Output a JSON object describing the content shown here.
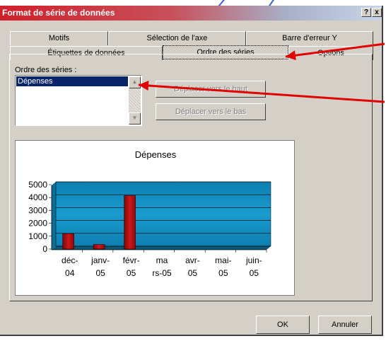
{
  "window": {
    "title": "Format de série de données",
    "help_label": "?",
    "close_label": "x"
  },
  "tabs": {
    "row1": [
      "Motifs",
      "Sélection de l'axe",
      "Barre d'erreur Y"
    ],
    "row2": [
      "Étiquettes de données",
      "Ordre des séries",
      "Options"
    ],
    "active": "Ordre des séries"
  },
  "series_order": {
    "label": "Ordre des séries :",
    "items": [
      "Dépenses"
    ],
    "selected": "Dépenses",
    "move_up_label": "Déplacer vers le haut",
    "move_down_label": "Déplacer vers le bas"
  },
  "footer": {
    "ok_label": "OK",
    "cancel_label": "Annuler"
  },
  "annotations": {
    "arrow_color": "#e00000",
    "arrow_count": 2
  },
  "colors": {
    "title_gradient_start": "#d0202a",
    "selection": "#0a246a",
    "plot_area": "#1a9ccf",
    "bar_fill": "#cc1818"
  },
  "chart_data": {
    "type": "bar",
    "title": "Dépenses",
    "categories": [
      [
        "déc-",
        "04"
      ],
      [
        "janv-",
        "05"
      ],
      [
        "févr-",
        "05"
      ],
      [
        "ma",
        "rs-05"
      ],
      [
        "avr-",
        "05"
      ],
      [
        "mai-",
        "05"
      ],
      [
        "juin-",
        "05"
      ]
    ],
    "series": [
      {
        "values": [
          1200,
          350,
          4150,
          0,
          0,
          0,
          0
        ]
      }
    ],
    "yticks": [
      "5000",
      "4000",
      "3000",
      "2000",
      "1000",
      "0"
    ],
    "ylim": [
      0,
      5000
    ],
    "grid": true,
    "legend": false
  }
}
